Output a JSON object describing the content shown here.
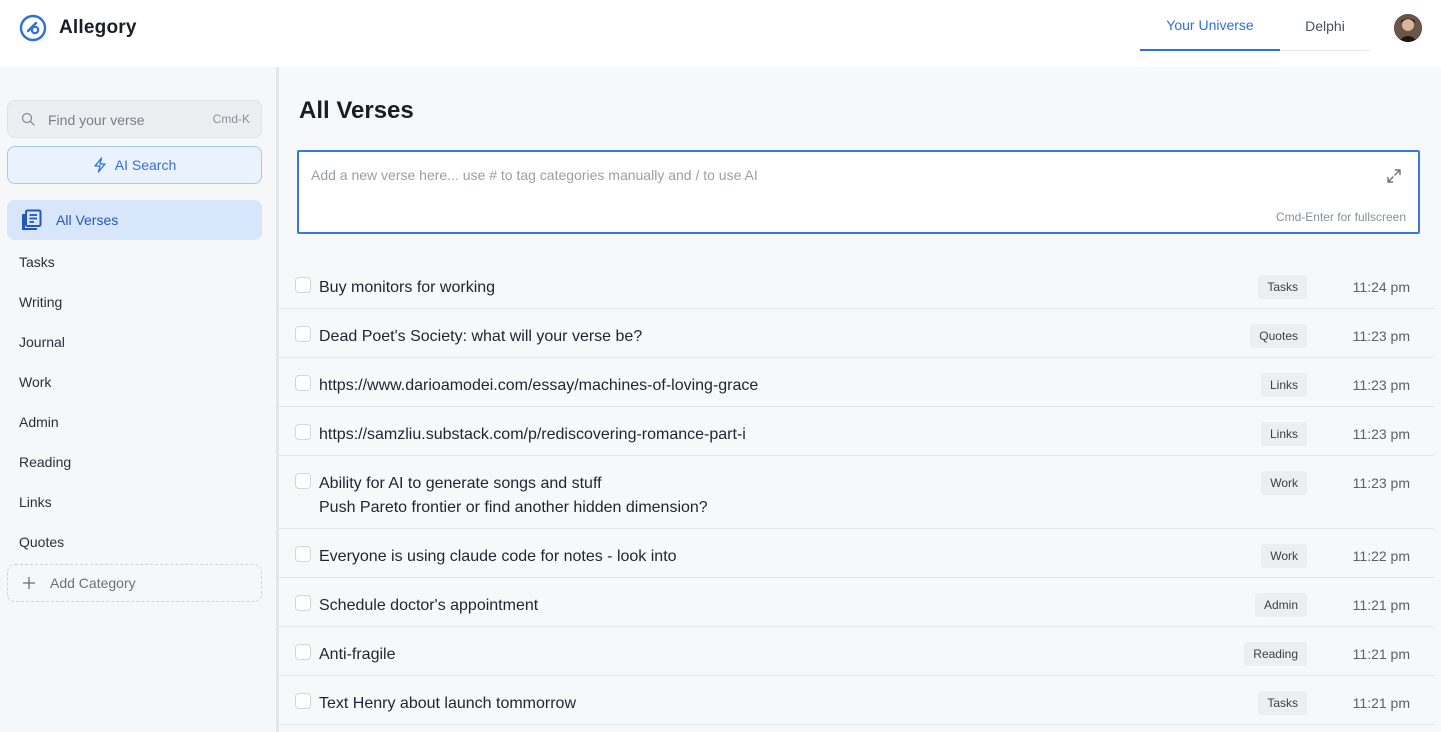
{
  "app": {
    "name": "Allegory",
    "accent_color": "#2f6fd8"
  },
  "header": {
    "tabs": [
      {
        "label": "Your Universe",
        "active": true
      },
      {
        "label": "Delphi",
        "active": false
      }
    ],
    "avatar_icon": "user-avatar"
  },
  "sidebar": {
    "search": {
      "placeholder": "Find your verse",
      "shortcut": "Cmd-K",
      "icon": "search-icon"
    },
    "ai_search_label": "AI Search",
    "all_verses_label": "All Verses",
    "categories": [
      "Tasks",
      "Writing",
      "Journal",
      "Work",
      "Admin",
      "Reading",
      "Links",
      "Quotes"
    ],
    "add_category_label": "Add Category"
  },
  "main": {
    "title": "All Verses",
    "composer": {
      "placeholder": "Add a new verse here... use # to tag categories manually and / to use AI",
      "hint": "Cmd-Enter for fullscreen"
    },
    "verses": [
      {
        "lines": [
          "Buy monitors for working"
        ],
        "tag": "Tasks",
        "time": "11:24 pm"
      },
      {
        "lines": [
          "Dead Poet's Society: what will your verse be?"
        ],
        "tag": "Quotes",
        "time": "11:23 pm"
      },
      {
        "lines": [
          "https://www.darioamodei.com/essay/machines-of-loving-grace"
        ],
        "tag": "Links",
        "time": "11:23 pm"
      },
      {
        "lines": [
          "https://samzliu.substack.com/p/rediscovering-romance-part-i"
        ],
        "tag": "Links",
        "time": "11:23 pm"
      },
      {
        "lines": [
          "Ability for AI to generate songs and stuff",
          "Push Pareto frontier or find another hidden dimension?"
        ],
        "tag": "Work",
        "time": "11:23 pm"
      },
      {
        "lines": [
          "Everyone is using claude code for notes - look into"
        ],
        "tag": "Work",
        "time": "11:22 pm"
      },
      {
        "lines": [
          "Schedule doctor's appointment"
        ],
        "tag": "Admin",
        "time": "11:21 pm"
      },
      {
        "lines": [
          "Anti-fragile"
        ],
        "tag": "Reading",
        "time": "11:21 pm"
      },
      {
        "lines": [
          "Text Henry about launch tommorrow"
        ],
        "tag": "Tasks",
        "time": "11:21 pm"
      }
    ]
  }
}
